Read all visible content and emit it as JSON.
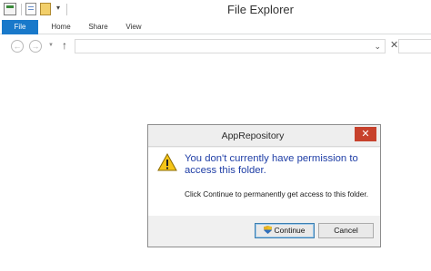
{
  "window": {
    "title": "File Explorer"
  },
  "ribbon": {
    "tabs": [
      {
        "label": "File",
        "active": true
      },
      {
        "label": "Home"
      },
      {
        "label": "Share"
      },
      {
        "label": "View"
      }
    ]
  },
  "navigation": {
    "address_value": "",
    "search_value": ""
  },
  "dialog": {
    "title": "AppRepository",
    "close_glyph": "✕",
    "icon": "warning-icon",
    "message": "You don't currently have permission to access this folder.",
    "detail": "Click Continue to permanently get access to this folder.",
    "buttons": {
      "continue_label": "Continue",
      "cancel_label": "Cancel"
    }
  },
  "colors": {
    "file_tab": "#1979ca",
    "message_text": "#1f3ea6",
    "close_button": "#c7412c"
  }
}
